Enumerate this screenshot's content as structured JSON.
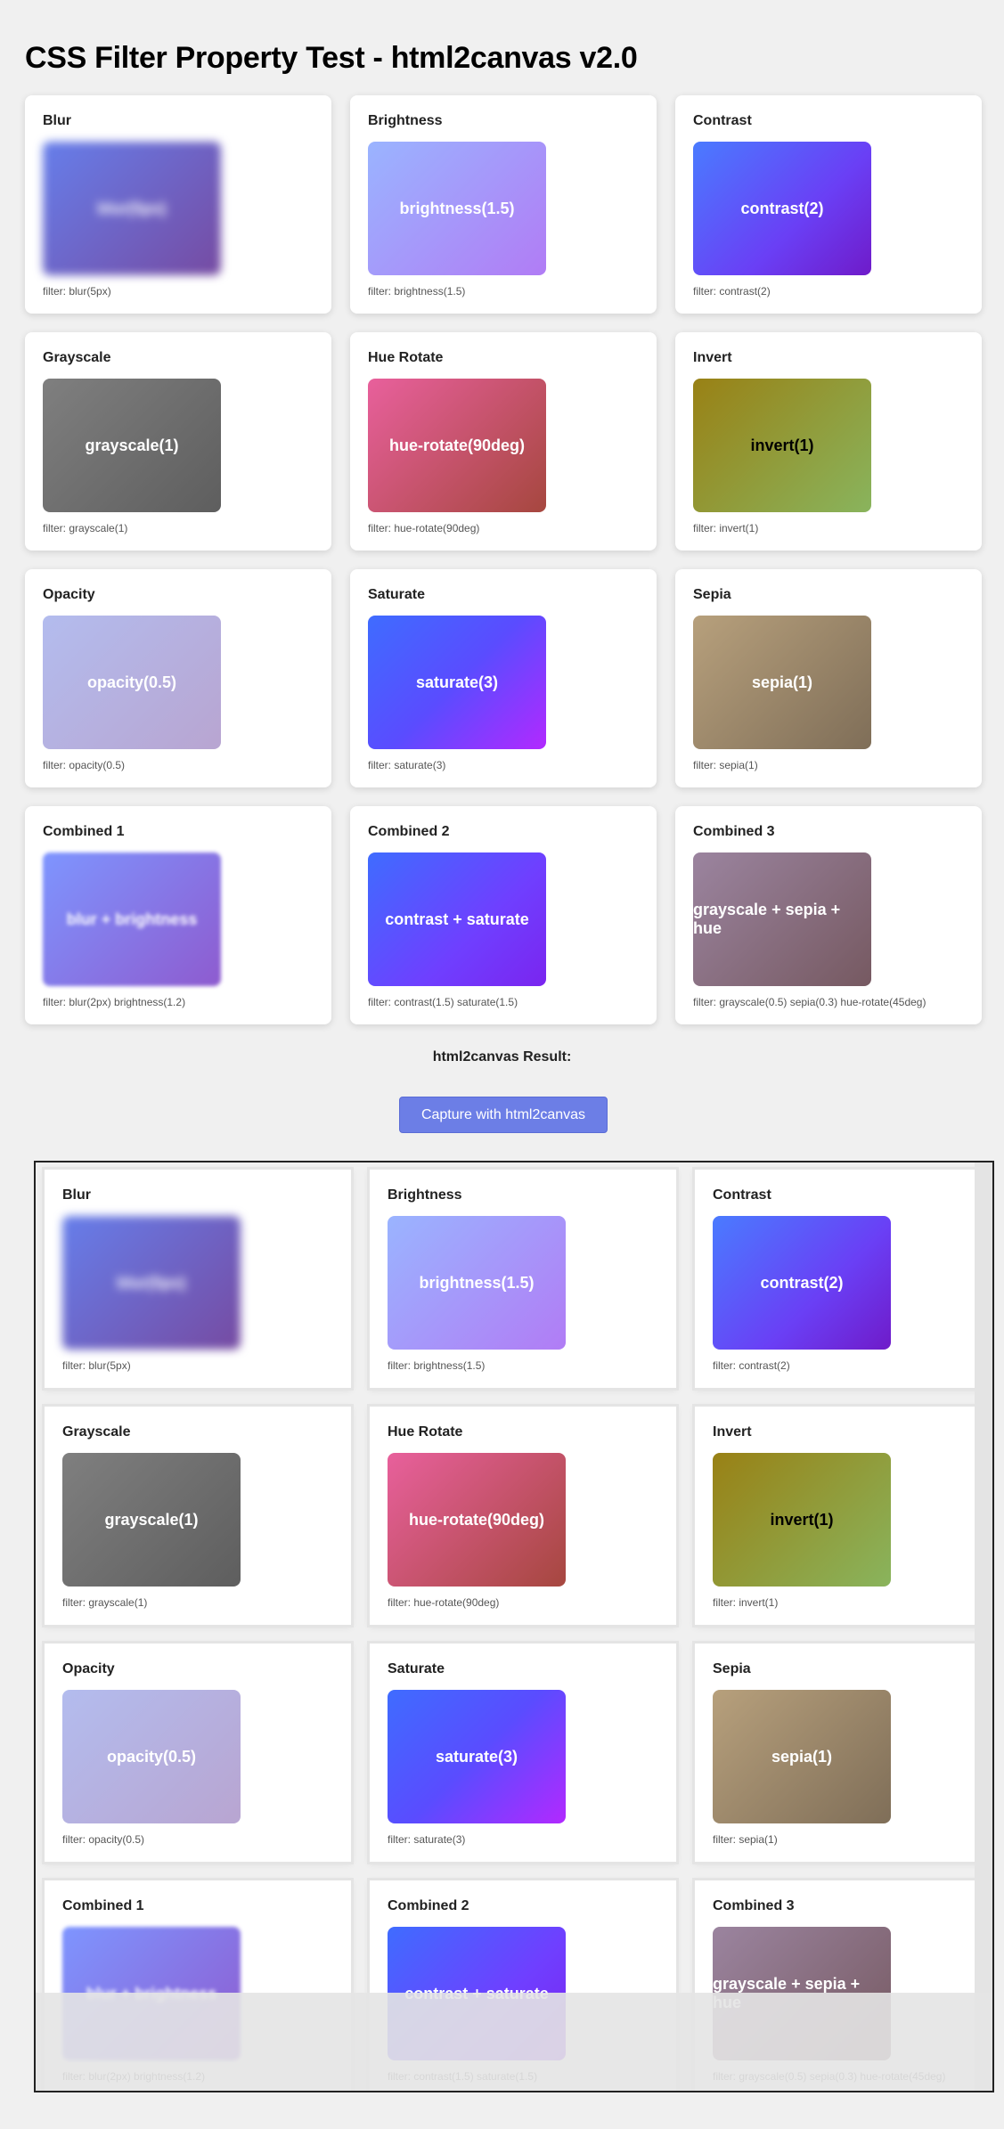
{
  "page": {
    "title": "CSS Filter Property Test - html2canvas v2.0"
  },
  "cards": [
    {
      "title": "Blur",
      "label": "blur(5px)",
      "caption": "filter: blur(5px)"
    },
    {
      "title": "Brightness",
      "label": "brightness(1.5)",
      "caption": "filter: brightness(1.5)"
    },
    {
      "title": "Contrast",
      "label": "contrast(2)",
      "caption": "filter: contrast(2)"
    },
    {
      "title": "Grayscale",
      "label": "grayscale(1)",
      "caption": "filter: grayscale(1)"
    },
    {
      "title": "Hue Rotate",
      "label": "hue-rotate(90deg)",
      "caption": "filter: hue-rotate(90deg)"
    },
    {
      "title": "Invert",
      "label": "invert(1)",
      "caption": "filter: invert(1)"
    },
    {
      "title": "Opacity",
      "label": "opacity(0.5)",
      "caption": "filter: opacity(0.5)"
    },
    {
      "title": "Saturate",
      "label": "saturate(3)",
      "caption": "filter: saturate(3)"
    },
    {
      "title": "Sepia",
      "label": "sepia(1)",
      "caption": "filter: sepia(1)"
    },
    {
      "title": "Combined 1",
      "label": "blur + brightness",
      "caption": "filter: blur(2px) brightness(1.2)"
    },
    {
      "title": "Combined 2",
      "label": "contrast + saturate",
      "caption": "filter: contrast(1.5) saturate(1.5)"
    },
    {
      "title": "Combined 3",
      "label": "grayscale + sepia + hue",
      "caption": "filter: grayscale(0.5) sepia(0.3) hue-rotate(45deg)"
    }
  ],
  "result": {
    "title": "html2canvas Result:",
    "button_label": "Capture with html2canvas"
  },
  "colors": {
    "background": "#f0f0f0",
    "button": "#6c7ee6",
    "card": "#ffffff"
  }
}
